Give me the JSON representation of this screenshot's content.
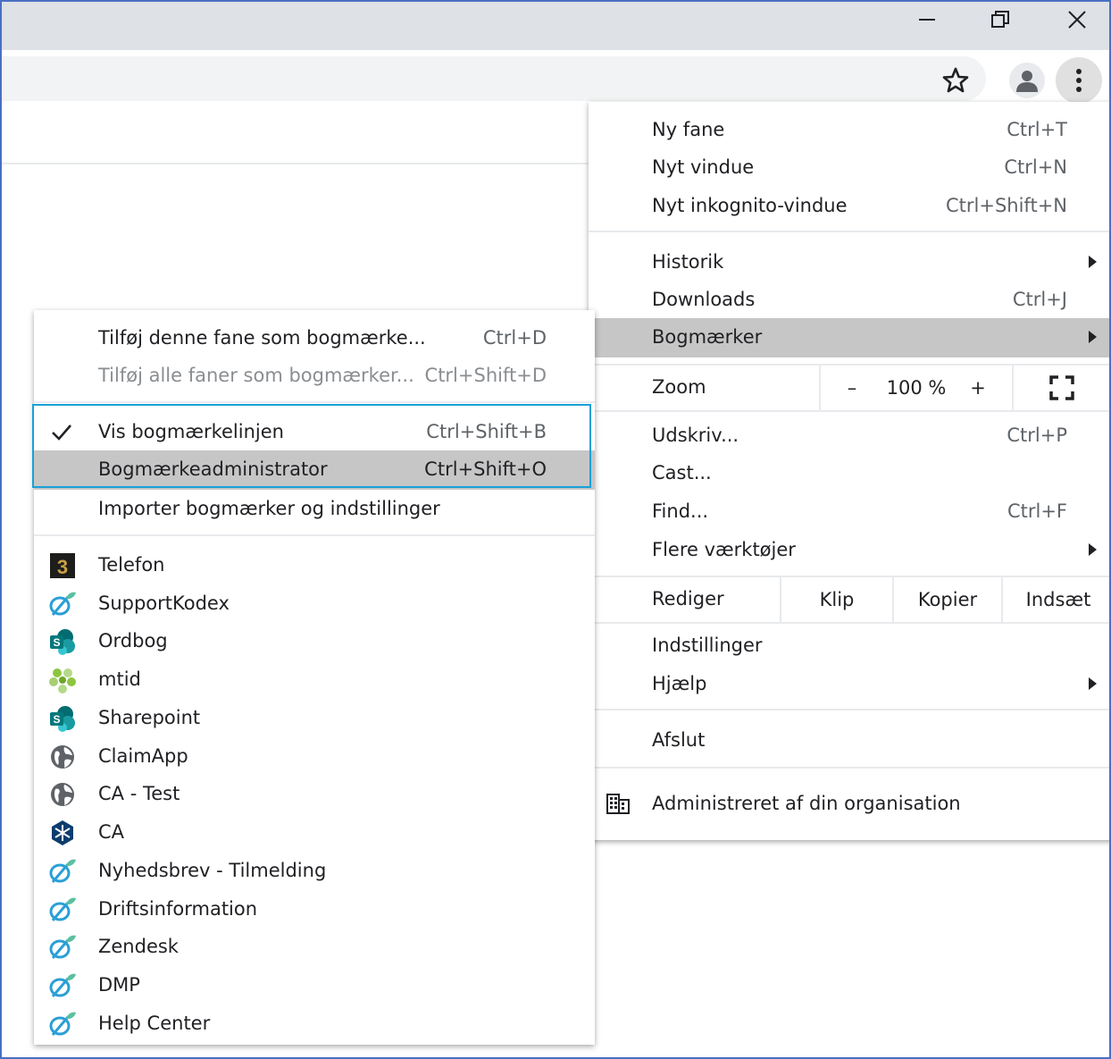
{
  "window": {
    "controls": [
      "minimize-icon",
      "restore-icon",
      "close-icon"
    ]
  },
  "toolbar": {
    "icons": [
      "star-icon",
      "profile-icon",
      "more-vert-icon"
    ]
  },
  "main_menu": {
    "new_tab": {
      "label": "Ny fane",
      "shortcut": "Ctrl+T"
    },
    "new_window": {
      "label": "Nyt vindue",
      "shortcut": "Ctrl+N"
    },
    "new_incognito": {
      "label": "Nyt inkognito-vindue",
      "shortcut": "Ctrl+Shift+N"
    },
    "history": {
      "label": "Historik"
    },
    "downloads": {
      "label": "Downloads",
      "shortcut": "Ctrl+J"
    },
    "bookmarks": {
      "label": "Bogmærker"
    },
    "zoom": {
      "label": "Zoom",
      "minus": "–",
      "value": "100 %",
      "plus": "+"
    },
    "print": {
      "label": "Udskriv...",
      "shortcut": "Ctrl+P"
    },
    "cast": {
      "label": "Cast..."
    },
    "find": {
      "label": "Find...",
      "shortcut": "Ctrl+F"
    },
    "more_tools": {
      "label": "Flere værktøjer"
    },
    "edit": {
      "label": "Rediger",
      "cut": "Klip",
      "copy": "Kopier",
      "paste": "Indsæt"
    },
    "settings": {
      "label": "Indstillinger"
    },
    "help": {
      "label": "Hjælp"
    },
    "exit": {
      "label": "Afslut"
    },
    "managed": {
      "label": "Administreret af din organisation"
    }
  },
  "bookmarks_menu": {
    "add_tab": {
      "label": "Tilføj denne fane som bogmærke...",
      "shortcut": "Ctrl+D"
    },
    "add_all": {
      "label": "Tilføj alle faner som bogmærker...",
      "shortcut": "Ctrl+Shift+D"
    },
    "show_bar": {
      "label": "Vis bogmærkelinjen",
      "shortcut": "Ctrl+Shift+B"
    },
    "manager": {
      "label": "Bogmærkeadministrator",
      "shortcut": "Ctrl+Shift+O"
    },
    "import": {
      "label": "Importer bogmærker og indstillinger"
    },
    "items": [
      {
        "label": "Telefon",
        "icon": "three-logo-icon"
      },
      {
        "label": "SupportKodex",
        "icon": "ring-leaf-icon"
      },
      {
        "label": "Ordbog",
        "icon": "sharepoint-icon"
      },
      {
        "label": "mtid",
        "icon": "green-cluster-icon"
      },
      {
        "label": "Sharepoint",
        "icon": "sharepoint-icon"
      },
      {
        "label": "ClaimApp",
        "icon": "globe-icon"
      },
      {
        "label": "CA - Test",
        "icon": "globe-icon"
      },
      {
        "label": "CA",
        "icon": "snowflake-icon"
      },
      {
        "label": "Nyhedsbrev - Tilmelding",
        "icon": "ring-leaf-icon"
      },
      {
        "label": "Driftsinformation",
        "icon": "ring-leaf-icon"
      },
      {
        "label": "Zendesk",
        "icon": "ring-leaf-icon"
      },
      {
        "label": "DMP",
        "icon": "ring-leaf-icon"
      },
      {
        "label": "Help Center",
        "icon": "ring-leaf-icon"
      }
    ]
  },
  "colors": {
    "highlight": "#c6c6c6",
    "focus_border": "#1aa1d6",
    "frame_border": "#4a6fc4"
  }
}
